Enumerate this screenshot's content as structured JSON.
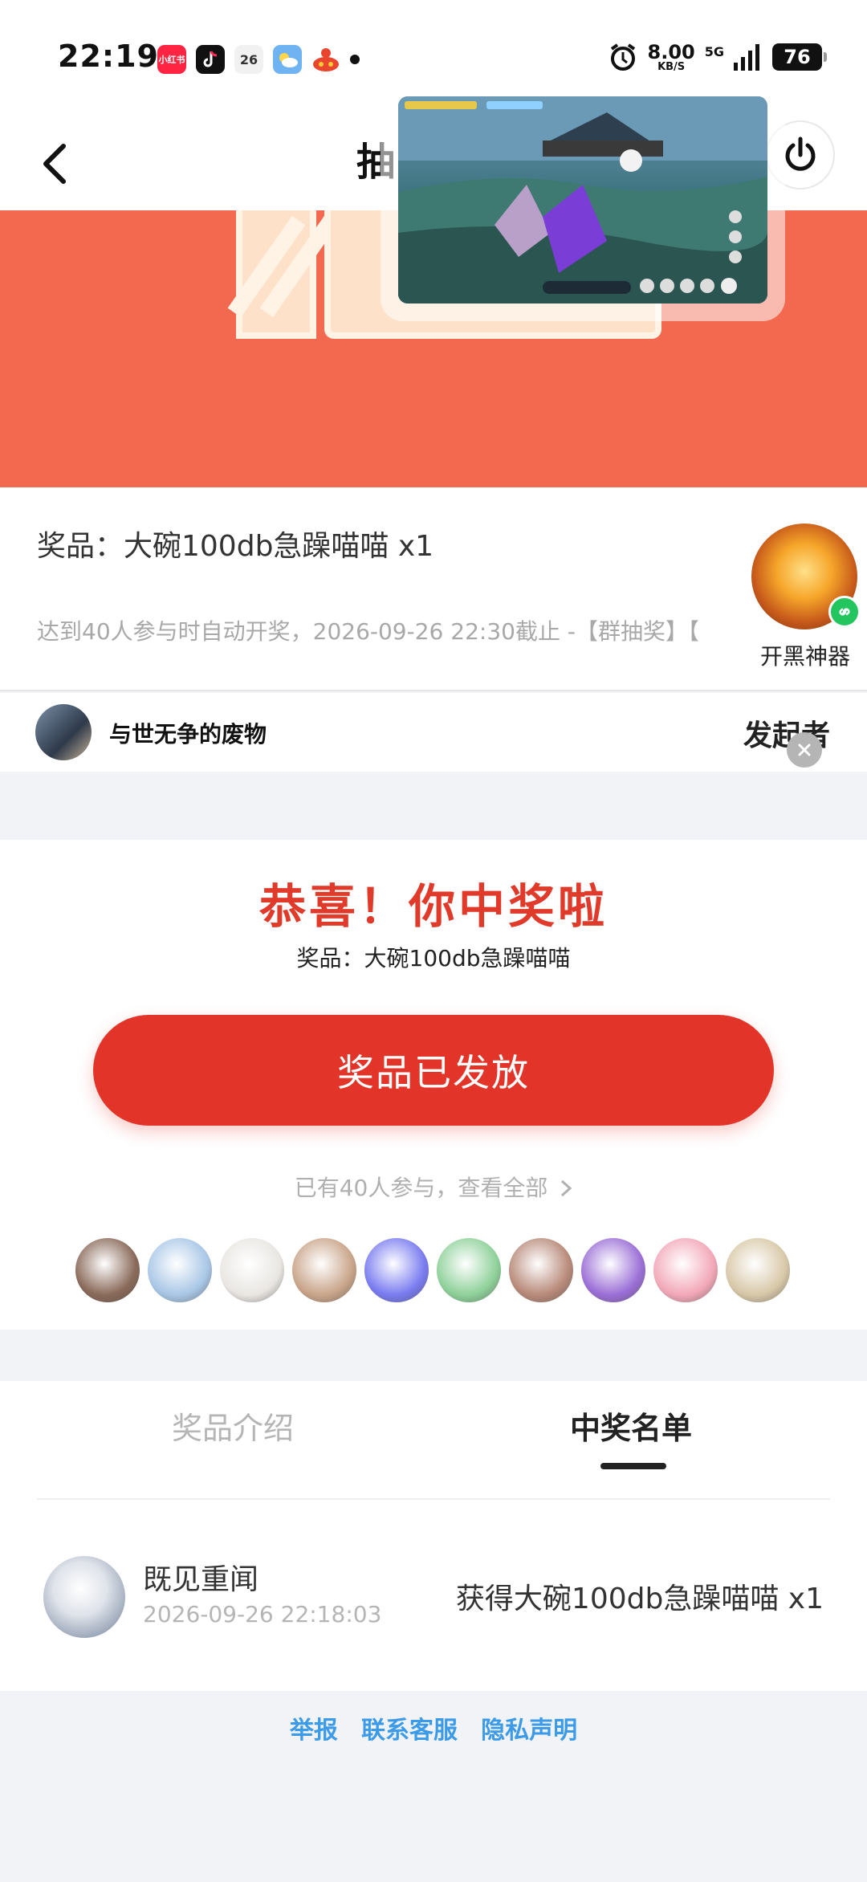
{
  "status_bar": {
    "time": "22:19",
    "apps": [
      {
        "icon": "xiaohongshu-icon",
        "text": "小红书",
        "color": "#ff2442"
      },
      {
        "icon": "douyin-icon",
        "text": "",
        "color": "#111111"
      },
      {
        "icon": "calendar-icon",
        "text": "26",
        "color": "#eeeeee"
      },
      {
        "icon": "weather-icon",
        "text": "",
        "color": "#6fb3f2"
      },
      {
        "icon": "app-icon",
        "text": "",
        "color": "#e9452f"
      }
    ],
    "speed_value": "8.00",
    "speed_unit": "KB/S",
    "network": "5G",
    "battery": "76"
  },
  "nav": {
    "title": "抽"
  },
  "prize": {
    "title": "奖品：大碗100db急躁喵喵 x1",
    "rule": "达到40人参与时自动开奖，2026-09-26 22:30截止 -【群抽奖】【",
    "initiator_name": "与世无争的废物",
    "initiator_role": "发起者"
  },
  "mini_program": {
    "label": "开黑神器"
  },
  "result": {
    "headline": "恭喜！你中奖啦",
    "subline": "奖品：大碗100db急躁喵喵",
    "button": "奖品已发放",
    "participants_link": "已有40人参与，查看全部",
    "avatar_colors": [
      "#8a6a5a",
      "#a9c7e6",
      "#e9e6e2",
      "#c9a58a",
      "#7a7cf0",
      "#8fd19a",
      "#b88a7a",
      "#9b6fd6",
      "#f2a8b8",
      "#d8c8a8"
    ]
  },
  "tabs": {
    "intro": "奖品介绍",
    "winners": "中奖名单"
  },
  "winner": {
    "name": "既见重闻",
    "time": "2026-09-26 22:18:03",
    "prize": "获得大碗100db急躁喵喵 x1"
  },
  "footer": {
    "report": "举报",
    "contact": "联系客服",
    "privacy": "隐私声明"
  }
}
